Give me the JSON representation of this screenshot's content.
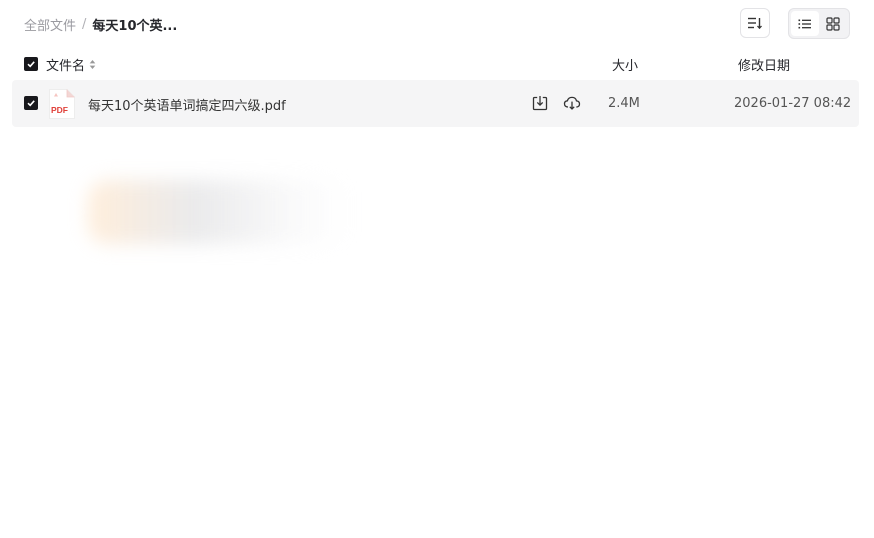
{
  "breadcrumb": {
    "root": "全部文件",
    "separator": "/",
    "current": "每天10个英..."
  },
  "toolbar": {
    "sort_icon": "sort-icon",
    "list_view_icon": "list-view-icon",
    "grid_view_icon": "grid-view-icon",
    "active_view": "list"
  },
  "table": {
    "columns": {
      "name": "文件名",
      "size": "大小",
      "modified": "修改日期"
    },
    "rows": [
      {
        "checked": true,
        "file_type_icon": "pdf-file-icon",
        "file_type_label": "PDF",
        "name": "每天10个英语单词搞定四六级.pdf",
        "actions": [
          "download-icon",
          "cloud-download-icon"
        ],
        "size": "2.4M",
        "modified": "2026-01-27 08:42"
      }
    ]
  },
  "colors": {
    "accent_dark": "#18181c",
    "row_background": "#f5f5f6",
    "pdf_red": "#e0403a"
  }
}
